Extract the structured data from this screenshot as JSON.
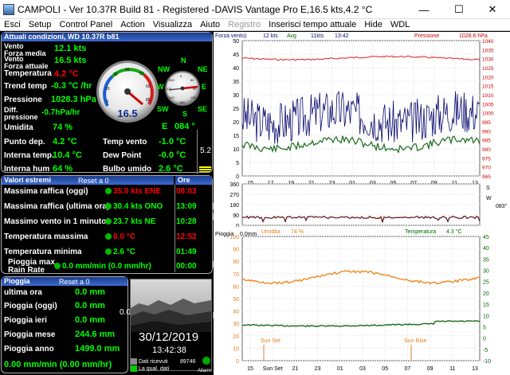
{
  "window": {
    "title": "CAMPOLI - Ver 10.37R Build 81 - Registered  -DAVIS Vantage Pro   E,16.5 kts,4.2 °C",
    "minimize": "—",
    "maximize": "☐",
    "close": "✕"
  },
  "menu": [
    "Esci",
    "Setup",
    "Control Panel",
    "Action",
    "Visualizza",
    "Aiuto",
    "Registro",
    "Inserisci tempo attuale",
    "Hide",
    "WDL"
  ],
  "current": {
    "header": "Attuali condizioni, WD 10.37R b81",
    "rows": [
      {
        "label": "Vento\nForza media",
        "value": "12.1 kts"
      },
      {
        "label": "Vento\nForza attuale",
        "value": "16.5 kts"
      },
      {
        "label": "Temperatura",
        "value": "4.2 °C"
      },
      {
        "label": "Trend temp",
        "value": "-0.3 °C /hr"
      },
      {
        "label": "Pressione",
        "value": "1028.3 hPa"
      },
      {
        "label": "Diff.\npressione",
        "value": "-0.7hPa/hr"
      },
      {
        "label": "Umidita",
        "value": "74 %"
      },
      {
        "label": "Punto dep.",
        "value": "4.2 °C"
      },
      {
        "label": "Interna temp.",
        "value": "10.4 °C"
      },
      {
        "label": "Interna hum",
        "value": "64 %"
      }
    ],
    "right_rows": [
      {
        "label": "Temp vento",
        "value": "-1.0 °C"
      },
      {
        "label": "Dew Point",
        "value": "-0.0 °C"
      },
      {
        "label": "Bulbo umido",
        "value": "2.6 °C"
      }
    ],
    "gauge_speed": "16.5",
    "gauge_scale": [
      "0",
      "10",
      "20",
      "30",
      "40",
      "50",
      "60",
      "70",
      "80"
    ],
    "compass_labels": {
      "n": "N",
      "ne": "NE",
      "e": "E",
      "se": "SE",
      "s": "S",
      "sw": "SW",
      "w": "W",
      "nw": "NW"
    },
    "compass_scale": [
      "0",
      "60",
      "90",
      "120",
      "180",
      "240",
      "270",
      "300"
    ],
    "direction": "E",
    "direction_deg": "084 °",
    "side_value": "5.2"
  },
  "extremes": {
    "header": "Valori estremi",
    "reset": "Reset a 0",
    "ore_header": "Ore",
    "rows": [
      {
        "label": "Massima raffica (oggi)",
        "value": "35.0 kts ENE",
        "color": "#ff0000",
        "time": "08:03"
      },
      {
        "label": "Massima raffica (ultima ora)",
        "value": "30.4 kts ONO",
        "color": "#00ff00",
        "time": "13:09"
      },
      {
        "label": "Massimo vento in 1 minuto",
        "value": "23.7 kts  NE",
        "color": "#00ff00",
        "time": "10:28"
      },
      {
        "label": "Temperatura massima",
        "value": "6.0 °C",
        "color": "#ff0000",
        "time": "12:52"
      },
      {
        "label": "Temperatura minima",
        "value": "2.6 °C",
        "color": "#00ff00",
        "time": "01:49"
      },
      {
        "label": "Pioggia max\nRain Rate",
        "value": "0.0 mm/min (0.0 mm/hr)",
        "color": "#00ff00",
        "time": "00:00"
      }
    ]
  },
  "rain": {
    "header": "Pioggia",
    "reset": "Reset a 0",
    "rows": [
      {
        "label": "ultima ora",
        "value": "0.0 mm"
      },
      {
        "label": "Pioggia (oggi)",
        "value": "0.0 mm"
      },
      {
        "label": "Pioggia ieri",
        "value": "0.0 mm"
      },
      {
        "label": "Pioggia mese",
        "value": "244.6 mm"
      },
      {
        "label": "Pioggia anno",
        "value": "1499.0 mm"
      }
    ],
    "rate": "0.00 mm/min (0.00 mm/hr)"
  },
  "webcam": {
    "side_label": "0.0",
    "date": "30/12/2019",
    "time": "13:42:38",
    "received_label": "Dati ricevuti",
    "received_value": "89746",
    "quality_label": "La qual. dati",
    "alarm_label": "Allarm"
  },
  "chart_wind": {
    "labels": {
      "forza": "Forza vento)",
      "kts1": "12 kts",
      "avg": "Avg",
      "kts2": "11kts",
      "time": "13:42",
      "pressione": "Pressione",
      "pvalue": "1028.6 hPa"
    },
    "y_left": [
      "50",
      "45",
      "40",
      "35",
      "30",
      "25",
      "20",
      "15",
      "10",
      "5",
      "0"
    ],
    "y_right": [
      "1040",
      "1035",
      "1030",
      "1025",
      "1020",
      "1015",
      "1010",
      "1005",
      "1000",
      "995",
      "990",
      "985",
      "980",
      "975",
      "970",
      "965"
    ],
    "x_ticks": [
      "15",
      "17",
      "19",
      "21",
      "23",
      "01",
      "03",
      "05",
      "07",
      "09",
      "11",
      "13"
    ]
  },
  "chart_dir": {
    "y_left": [
      "360",
      "270",
      "180",
      "90",
      "0"
    ],
    "label_s": "S",
    "label_w": "W",
    "side": "083°",
    "umidita": "Umidita",
    "umidita_val": "74 %",
    "temperatura": "Temperatura",
    "temp_val": "4.3 °C"
  },
  "chart_temp": {
    "labels": {
      "pioggia": "Pioggia",
      "pval": "0.0mm"
    },
    "y_left": [
      "100",
      "90",
      "80",
      "70",
      "60",
      "50",
      "40",
      "30",
      "20",
      "10",
      "0"
    ],
    "y_right": [
      "45",
      "40",
      "35",
      "30",
      "25",
      "20",
      "15",
      "10",
      "5",
      "0",
      "-5",
      "-10"
    ],
    "x_ticks": [
      "15",
      "Sun Set",
      "21",
      "23",
      "01",
      "03",
      "05",
      "07",
      "09",
      "11",
      "13"
    ],
    "sun_set": "Sun Set",
    "sun_rise": "Sun Rise"
  },
  "colors": {
    "green": "#00ff00",
    "red": "#ff0000",
    "header_blue": "#2850b4",
    "navy": "#0a0a6e",
    "orange": "#ee8822",
    "darkgreen": "#1a6a1a",
    "maroon": "#5a1212"
  }
}
